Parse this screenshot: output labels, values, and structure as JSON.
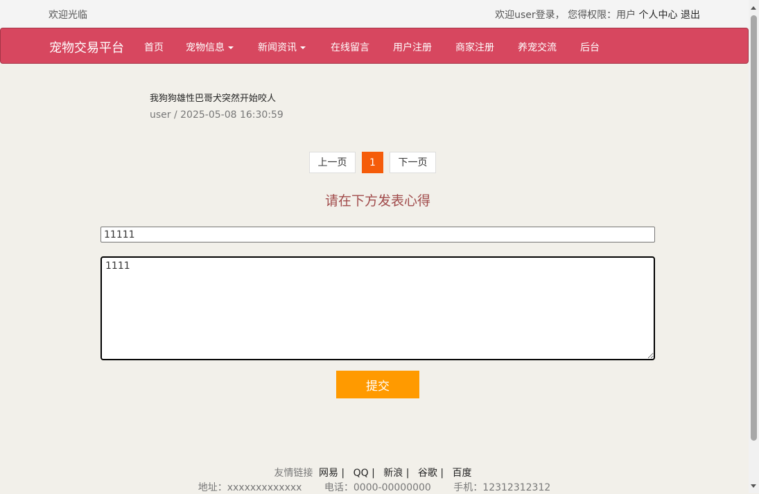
{
  "topbar": {
    "welcome": "欢迎光临",
    "login_status": "欢迎user登录，  您得权限：用户",
    "user_center": "个人中心",
    "logout": "退出"
  },
  "nav": {
    "brand": "宠物交易平台",
    "items": [
      {
        "label": "首页"
      },
      {
        "label": "宠物信息"
      },
      {
        "label": "新闻资讯"
      },
      {
        "label": "在线留言"
      },
      {
        "label": "用户注册"
      },
      {
        "label": "商家注册"
      },
      {
        "label": "养宠交流"
      },
      {
        "label": "后台"
      }
    ]
  },
  "post": {
    "title": "我狗狗雄性巴哥犬突然开始咬人",
    "meta": "user / 2025-05-08 16:30:59"
  },
  "pagination": {
    "prev": "上一页",
    "current": "1",
    "next": "下一页"
  },
  "form": {
    "heading": "请在下方发表心得",
    "title_value": "11111",
    "content_value": "1111",
    "submit": "提交"
  },
  "footer": {
    "links_label": "友情链接",
    "links": [
      "网易 |",
      "QQ |",
      "新浪 |",
      "谷歌 |",
      "百度"
    ],
    "address": "地址：xxxxxxxxxxxxx",
    "phone": "电话：0000-00000000",
    "mobile": "手机：12312312312"
  }
}
